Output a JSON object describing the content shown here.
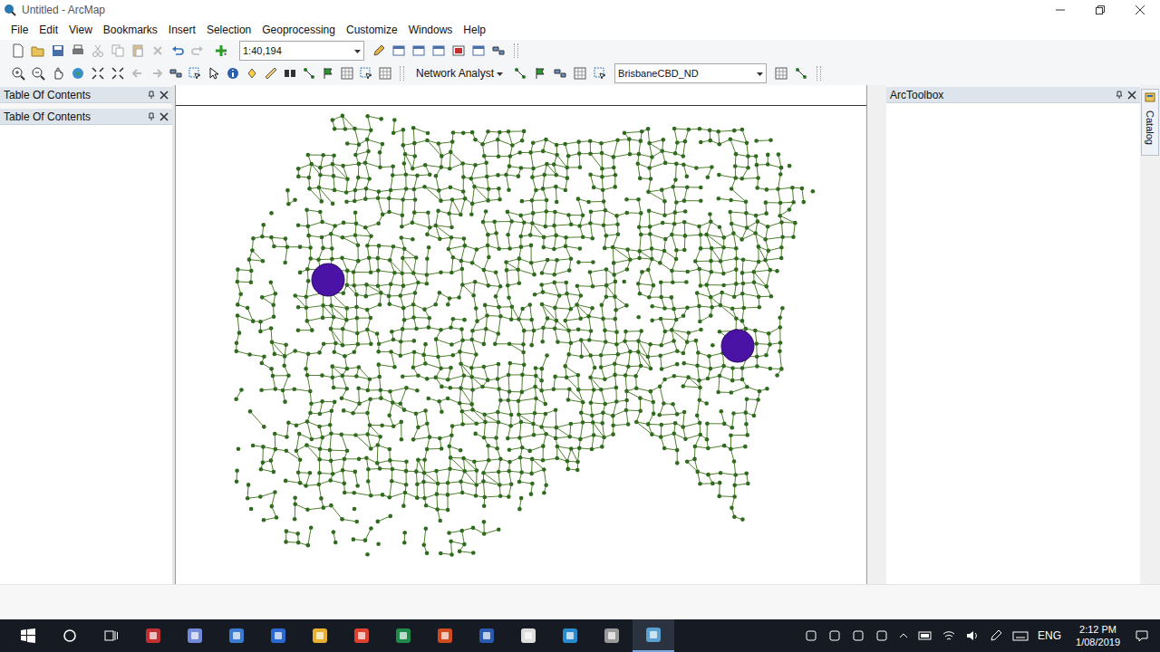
{
  "window": {
    "title": "Untitled - ArcMap"
  },
  "menu": [
    "File",
    "Edit",
    "View",
    "Bookmarks",
    "Insert",
    "Selection",
    "Geoprocessing",
    "Customize",
    "Windows",
    "Help"
  ],
  "toolbar": {
    "scale": "1:40,194",
    "network_analyst": "Network Analyst",
    "network_dataset": "BrisbaneCBD_ND"
  },
  "panels": {
    "left": [
      "Table Of Contents",
      "Table Of Contents"
    ],
    "right": "ArcToolbox",
    "side_tab": "Catalog"
  },
  "taskbar": {
    "language": "ENG",
    "time": "2:12 PM",
    "date": "1/08/2019"
  }
}
